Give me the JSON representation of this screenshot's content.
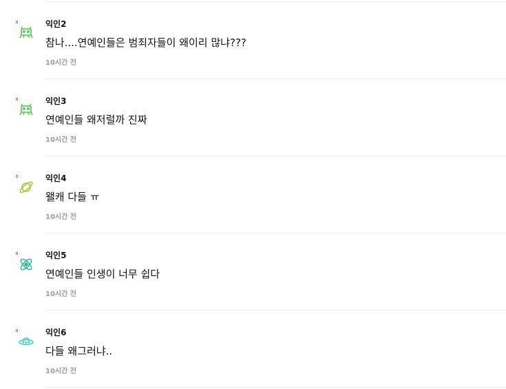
{
  "comments": [
    {
      "author": "익인2",
      "text": "참나....연예인들은 범죄자들이 왜이리 많냐???",
      "time": "10시간 전",
      "avatar_icon": "space-invader-icon",
      "avatar_color": "#4cc94c"
    },
    {
      "author": "익인3",
      "text": "연예인들 왜저럴까 진짜",
      "time": "10시간 전",
      "avatar_icon": "space-invader-icon",
      "avatar_color": "#4cc94c"
    },
    {
      "author": "익인4",
      "text": "왤캐 다들 ㅠ",
      "time": "10시간 전",
      "avatar_icon": "planet-icon",
      "avatar_color": "#a8c23a"
    },
    {
      "author": "익인5",
      "text": "연예인들 인생이 너무 쉽다",
      "time": "10시간 전",
      "avatar_icon": "atom-icon",
      "avatar_color": "#2fb6a0"
    },
    {
      "author": "익인6",
      "text": "다들 왜그러냐..",
      "time": "10시간 전",
      "avatar_icon": "ufo-icon",
      "avatar_color": "#3cc9b4"
    }
  ]
}
